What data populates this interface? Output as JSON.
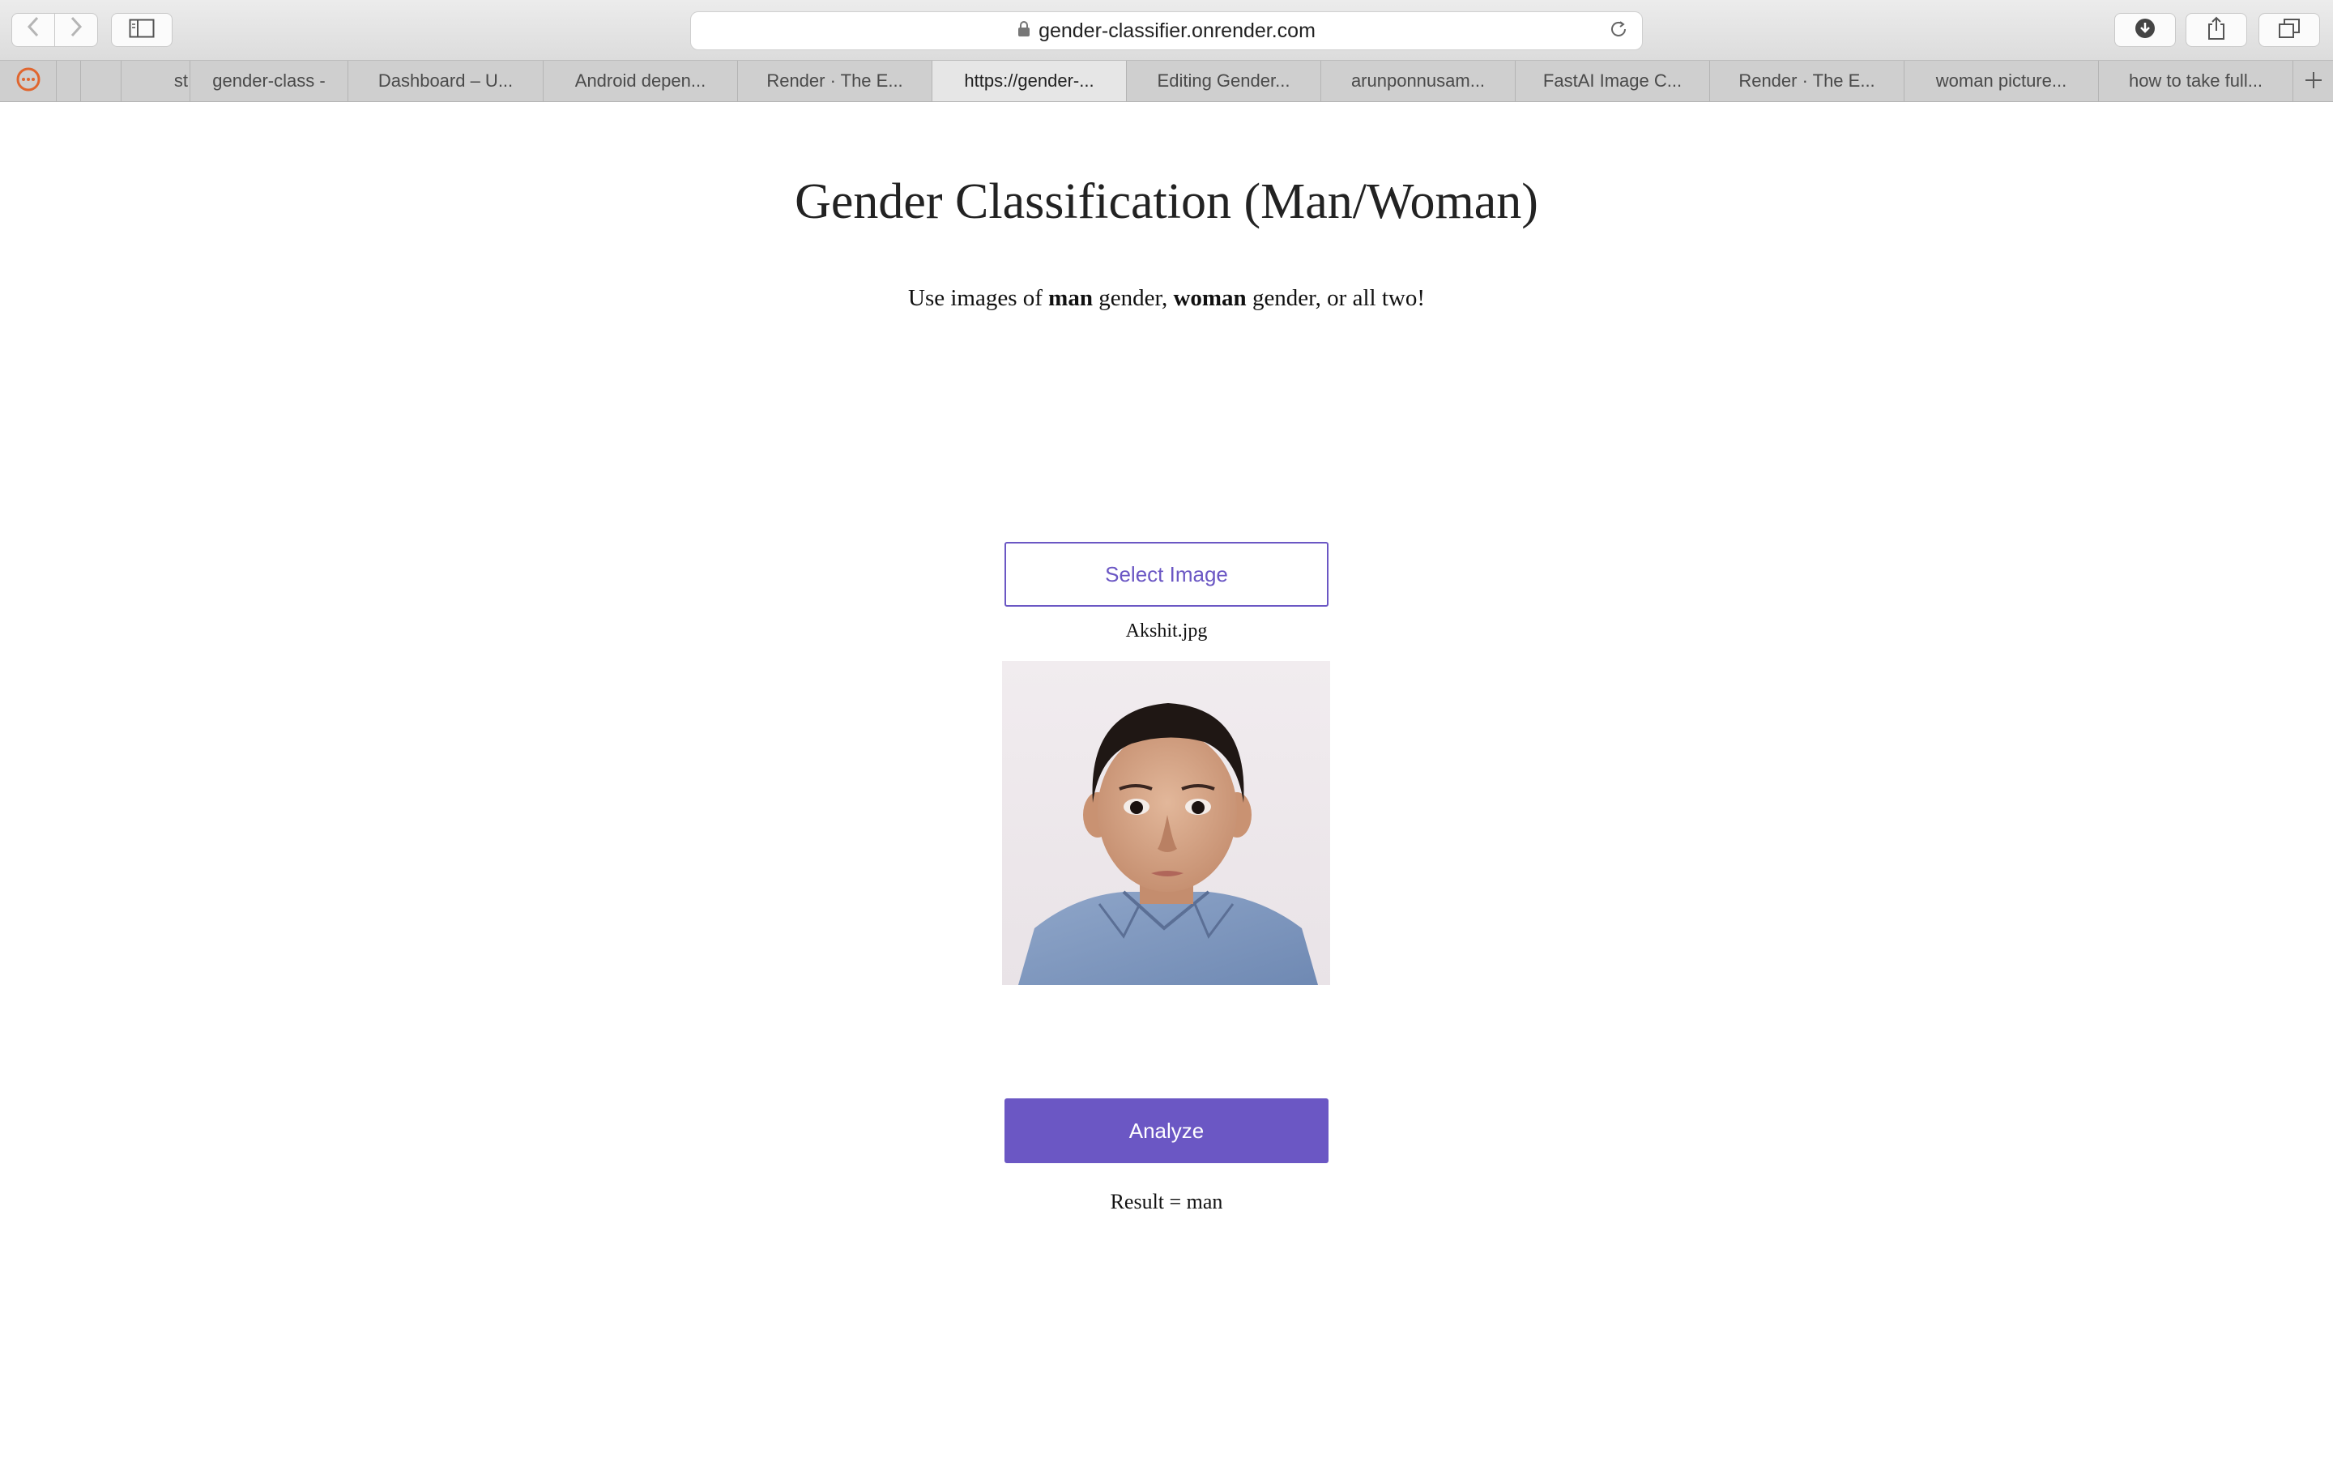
{
  "browser": {
    "address": "gender-classifier.onrender.com",
    "tabs": [
      {
        "label": "st",
        "active": false
      },
      {
        "label": "gender-class -",
        "active": false
      },
      {
        "label": "Dashboard – U...",
        "active": false
      },
      {
        "label": "Android depen...",
        "active": false
      },
      {
        "label": "Render · The E...",
        "active": false
      },
      {
        "label": "https://gender-...",
        "active": true
      },
      {
        "label": "Editing Gender...",
        "active": false
      },
      {
        "label": "arunponnusam...",
        "active": false
      },
      {
        "label": "FastAI Image C...",
        "active": false
      },
      {
        "label": "Render · The E...",
        "active": false
      },
      {
        "label": "woman picture...",
        "active": false
      },
      {
        "label": "how to take full...",
        "active": false
      }
    ],
    "icons": {
      "back": "chevron-left-icon",
      "forward": "chevron-right-icon",
      "sidebar": "sidebar-icon",
      "lock": "lock-icon",
      "reload": "reload-icon",
      "downloads": "download-icon",
      "share": "share-icon",
      "tabs_overview": "tabs-overview-icon",
      "new_tab": "plus-icon"
    }
  },
  "page": {
    "title": "Gender Classification (Man/Woman)",
    "subtitle": {
      "prefix": "Use images of ",
      "bold1": "man",
      "middle": " gender, ",
      "bold2": "woman",
      "suffix": " gender, or all two!"
    },
    "select_button": "Select Image",
    "filename": "Akshit.jpg",
    "analyze_button": "Analyze",
    "result": "Result = man"
  },
  "colors": {
    "accent": "#6b57c4",
    "toolbar": "#dcdcdc",
    "tabbar": "#cfcfcf"
  }
}
